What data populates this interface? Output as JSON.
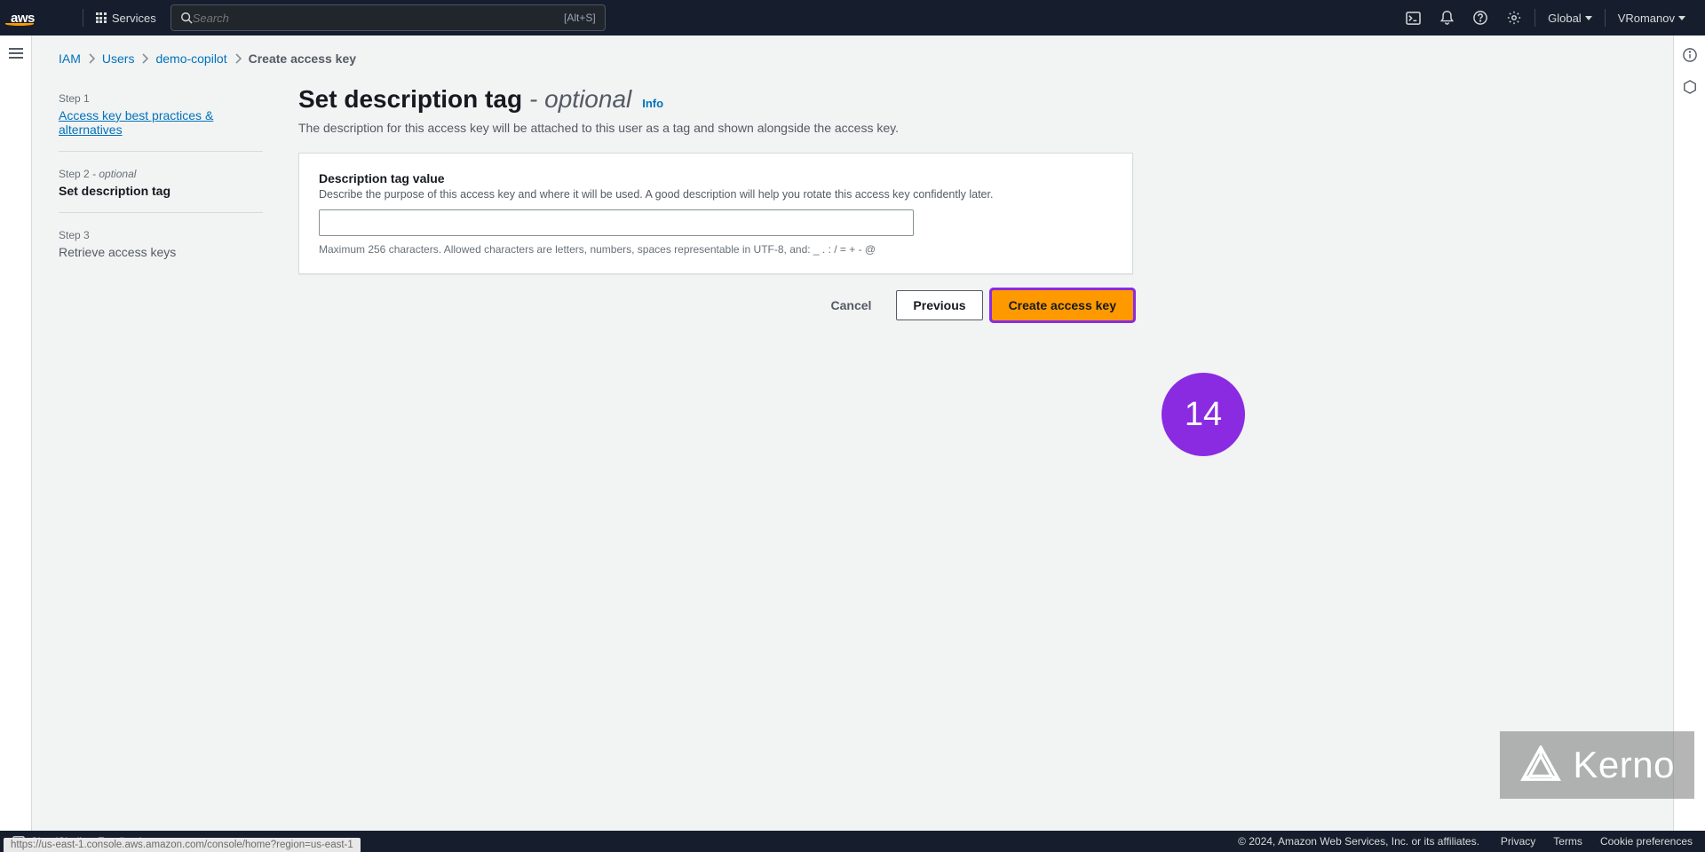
{
  "header": {
    "logo": "aws",
    "services_label": "Services",
    "search_placeholder": "Search",
    "search_shortcut": "[Alt+S]",
    "region": "Global",
    "user": "VRomanov"
  },
  "breadcrumb": {
    "items": [
      {
        "label": "IAM",
        "link": true
      },
      {
        "label": "Users",
        "link": true
      },
      {
        "label": "demo-copilot",
        "link": true
      },
      {
        "label": "Create access key",
        "link": false
      }
    ]
  },
  "wizard": {
    "steps": [
      {
        "num": "Step 1",
        "optional": "",
        "title": "Access key best practices & alternatives",
        "link": true,
        "active": false
      },
      {
        "num": "Step 2",
        "optional": " - optional",
        "title": "Set description tag",
        "link": false,
        "active": true
      },
      {
        "num": "Step 3",
        "optional": "",
        "title": "Retrieve access keys",
        "link": false,
        "active": false
      }
    ]
  },
  "page": {
    "title_main": "Set description tag",
    "title_sep": " - ",
    "title_optional": "optional",
    "info_label": "Info",
    "description": "The description for this access key will be attached to this user as a tag and shown alongside the access key."
  },
  "panel": {
    "field_label": "Description tag value",
    "field_hint": "Describe the purpose of this access key and where it will be used. A good description will help you rotate this access key confidently later.",
    "field_value": "",
    "field_below": "Maximum 256 characters. Allowed characters are letters, numbers, spaces representable in UTF-8, and: _ . : / = + - @"
  },
  "buttons": {
    "cancel": "Cancel",
    "previous": "Previous",
    "create": "Create access key"
  },
  "annotation": {
    "badge": "14"
  },
  "footer": {
    "cloudshell": "CloudShell",
    "feedback": "Feedback",
    "status_url": "https://us-east-1.console.aws.amazon.com/console/home?region=us-east-1",
    "copyright": "© 2024, Amazon Web Services, Inc. or its affiliates.",
    "privacy": "Privacy",
    "terms": "Terms",
    "cookies": "Cookie preferences"
  },
  "watermark": {
    "text": "Kerno"
  }
}
